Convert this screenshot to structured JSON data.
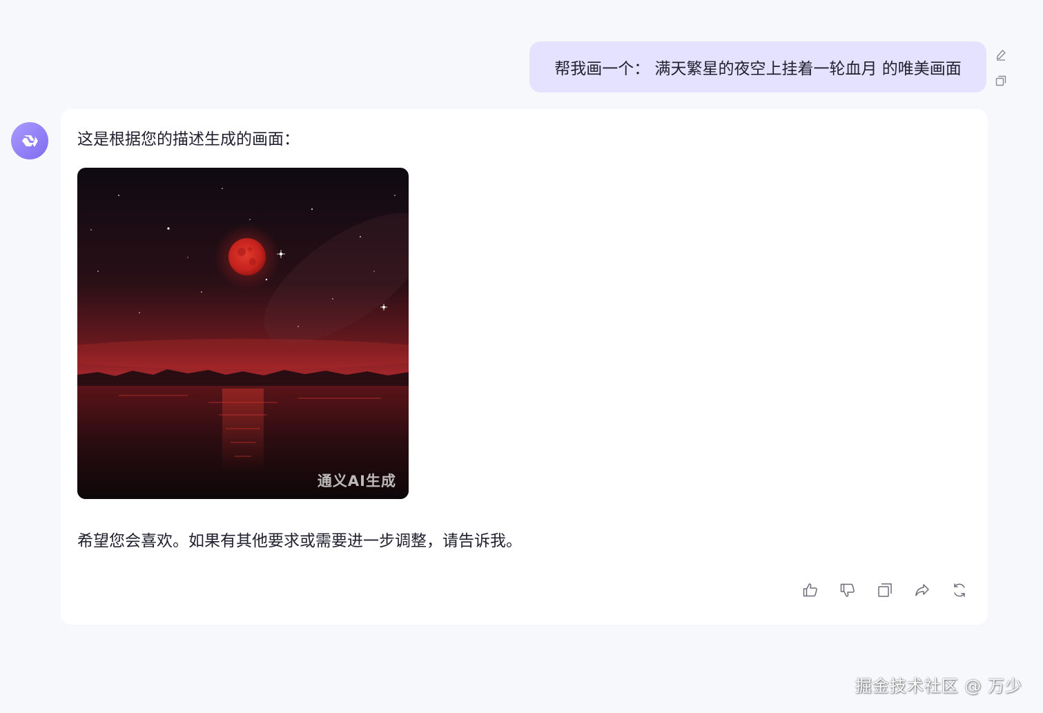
{
  "user_message": {
    "text": "帮我画一个： 满天繁星的夜空上挂着一轮血月 的唯美画面",
    "actions": [
      {
        "name": "edit",
        "icon": "pencil-icon"
      },
      {
        "name": "copy",
        "icon": "copy-icon"
      }
    ]
  },
  "assistant": {
    "avatar_icon": "tongyi-logo-icon",
    "intro_text": "这是根据您的描述生成的画面：",
    "image": {
      "description_icon": "blood-moon-image",
      "watermark": "通义AI生成"
    },
    "outro_text": "希望您会喜欢。如果有其他要求或需要进一步调整，请告诉我。",
    "actions": [
      {
        "name": "like",
        "icon": "thumbs-up-icon"
      },
      {
        "name": "dislike",
        "icon": "thumbs-down-icon"
      },
      {
        "name": "copy",
        "icon": "copy-icon"
      },
      {
        "name": "share",
        "icon": "share-icon"
      },
      {
        "name": "regenerate",
        "icon": "refresh-icon"
      }
    ]
  },
  "footer": {
    "credit": "掘金技术社区 @ 万少"
  },
  "colors": {
    "background": "#f7f8fc",
    "user_bubble": "#e5e2ff",
    "card": "#ffffff",
    "accent": "#8b7cf6",
    "icon_gray": "#6b6b78"
  }
}
